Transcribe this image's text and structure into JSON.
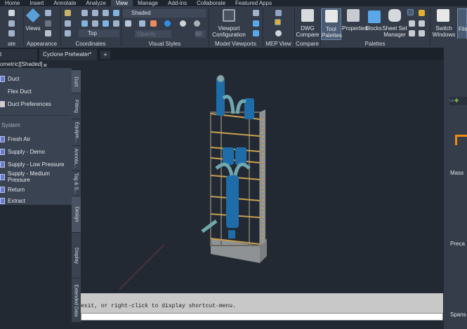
{
  "ribbon_tabs": [
    "Home",
    "Insert",
    "Annotate",
    "Analyze",
    "View",
    "Manage",
    "Add-ins",
    "Collaborate",
    "Featured Apps"
  ],
  "active_tab": "View",
  "panels": {
    "create": "ate",
    "appearance": "Appearance",
    "coordinates": "Coordinates",
    "visual_styles": "Visual Styles",
    "model_viewports": "Model Viewports",
    "mep_view": "MEP View",
    "compare": "Compare",
    "palettes": "Palettes"
  },
  "buttons": {
    "views": "Views",
    "viewport_config": "Viewport\nConfiguration",
    "dwg_compare": "DWG Compare",
    "tool_palettes": "Tool Palettes",
    "properties": "Properties",
    "blocks": "Blocks",
    "sheet_set": "Sheet Set Manager",
    "switch_windows": "Switch Windows",
    "file": "File"
  },
  "visual_style": "Shaded",
  "view_select": "Top",
  "opacity_placeholder": "Opacity",
  "opacity_value": "60",
  "doc_tabs": [
    {
      "label": "t"
    },
    {
      "label": "Cyclone Preheater*"
    }
  ],
  "viewport_label": "ometric][Shaded]",
  "palette": {
    "items": [
      "Duct",
      "Flex Duct",
      "Duct Preferences"
    ],
    "section": "System",
    "systems": [
      "Fresh Air",
      "Supply - Demo",
      "Supply - Low Pressure",
      "Supply - Medium Pressure",
      "Return",
      "Extract"
    ]
  },
  "vertical_tabs": [
    "Duct",
    "Fitting",
    "Equipm...",
    "Annota...",
    "Tag & S...",
    "Design",
    "Display",
    "Extended Data"
  ],
  "command_text": "exit, or right-click to display shortcut-menu.",
  "right_panel": [
    "Mass",
    "Preca",
    "Spans"
  ],
  "colors": {
    "accent": "#6c8bb0",
    "viewport": "#222933"
  }
}
